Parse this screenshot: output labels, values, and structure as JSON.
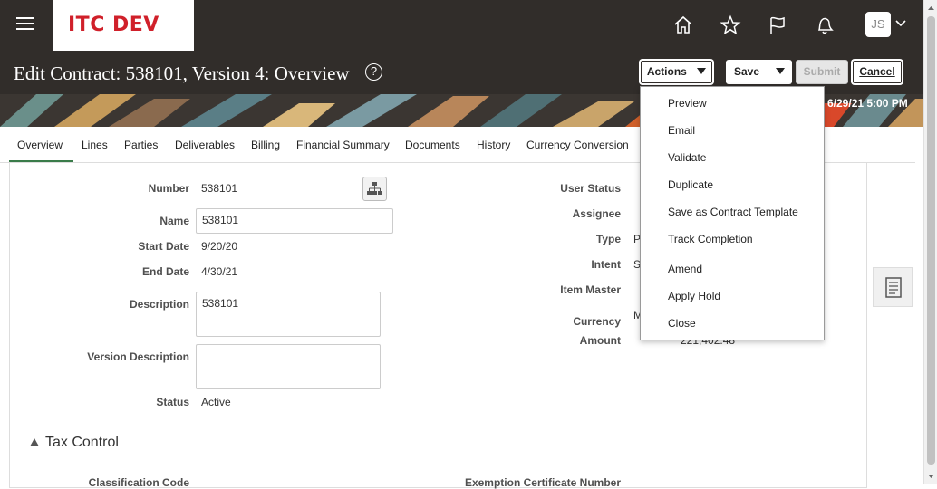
{
  "header": {
    "logo_text": "ITC DEV",
    "avatar_initials": "JS",
    "page_title": "Edit Contract: 538101, Version 4: Overview",
    "help_glyph": "?",
    "date_text": "6/29/21 5:00 PM"
  },
  "toolbar": {
    "actions_label": "Actions",
    "save_label": "Save",
    "submit_label": "Submit",
    "cancel_label": "Cancel"
  },
  "tabs": [
    {
      "label": "Overview",
      "active": true
    },
    {
      "label": "Lines"
    },
    {
      "label": "Parties"
    },
    {
      "label": "Deliverables"
    },
    {
      "label": "Billing"
    },
    {
      "label": "Financial Summary"
    },
    {
      "label": "Documents"
    },
    {
      "label": "History"
    },
    {
      "label": "Currency Conversion"
    }
  ],
  "form": {
    "number_label": "Number",
    "number_value": "538101",
    "name_label": "Name",
    "name_value": "538101",
    "start_date_label": "Start Date",
    "start_date_value": "9/20/20",
    "end_date_label": "End Date",
    "end_date_value": "4/30/21",
    "description_label": "Description",
    "description_value": "538101",
    "version_description_label": "Version Description",
    "version_description_value": "",
    "status_label": "Status",
    "status_value": "Active",
    "user_status_label": "User Status",
    "assignee_label": "Assignee",
    "type_label": "Type",
    "type_value_partial": "P",
    "intent_label": "Intent",
    "intent_value_partial": "S",
    "item_master_label": "Item Master",
    "currency_label": "Currency",
    "currency_value_partial": "M",
    "amount_label": "Amount",
    "amount_value_partial": "221,402.48",
    "tax_control_title": "Tax Control",
    "classification_code_label": "Classification Code",
    "exemption_label": "Exemption Certificate Number"
  },
  "actions_menu": {
    "items_group1": [
      "Preview",
      "Email",
      "Validate",
      "Duplicate",
      "Save as Contract Template",
      "Track Completion"
    ],
    "items_group2": [
      "Amend",
      "Apply Hold",
      "Close"
    ]
  },
  "colors": {
    "header_bg": "#312d2a",
    "logo_red": "#d0202a",
    "tab_active": "#3a7c4a"
  },
  "icons": [
    "hamburger-menu-icon",
    "home-icon",
    "star-icon",
    "flag-icon",
    "bell-icon",
    "chevron-down-icon",
    "help-icon",
    "hierarchy-icon",
    "document-icon",
    "caret-down-icon",
    "expand-triangle-icon"
  ]
}
